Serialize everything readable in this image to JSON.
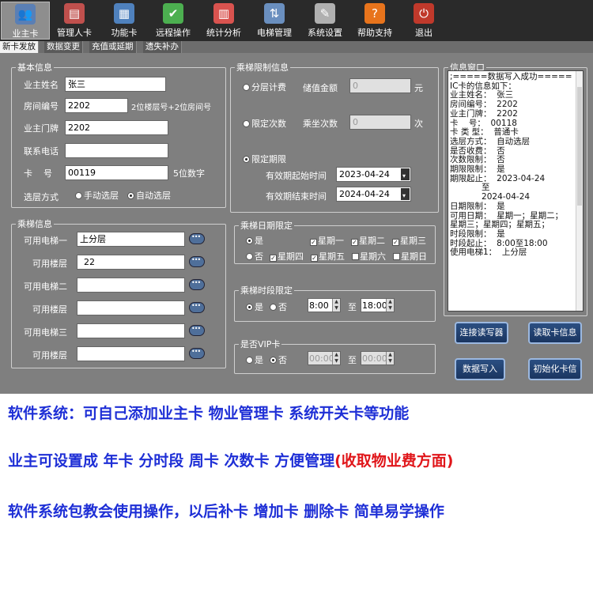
{
  "toolbar": {
    "items": [
      {
        "label": "业主卡",
        "icon": "users-icon",
        "color": "#5a7fb5"
      },
      {
        "label": "管理人卡",
        "icon": "id-card-icon",
        "color": "#c0504d"
      },
      {
        "label": "功能卡",
        "icon": "function-card-icon",
        "color": "#4f81bd"
      },
      {
        "label": "远程操作",
        "icon": "shield-check-icon",
        "color": "#4caf50"
      },
      {
        "label": "统计分析",
        "icon": "calendar-icon",
        "color": "#d9534f"
      },
      {
        "label": "电梯管理",
        "icon": "elevator-icon",
        "color": "#6a8fbf"
      },
      {
        "label": "系统设置",
        "icon": "wrench-icon",
        "color": "#b0b0b0"
      },
      {
        "label": "帮助支持",
        "icon": "help-icon",
        "color": "#e8741c"
      },
      {
        "label": "退出",
        "icon": "logout-icon",
        "color": "#c0392b"
      }
    ]
  },
  "tabs": [
    "新卡发放",
    "数据变更",
    "充值或延期",
    "遗失补办"
  ],
  "basic": {
    "legend": "基本信息",
    "owner_label": "业主姓名",
    "owner_value": "张三",
    "room_label": "房间编号",
    "room_value": "2202",
    "room_hint": "2位楼层号+2位房间号",
    "door_label": "业主门牌",
    "door_value": "2202",
    "phone_label": "联系电话",
    "phone_value": "",
    "card_label": "卡    号",
    "card_value": "00119",
    "card_hint": "5位数字",
    "floor_mode_label": "选层方式",
    "manual": "手动选层",
    "auto": "自动选层"
  },
  "limit": {
    "legend": "乘梯限制信息",
    "floor_fee": "分层计费",
    "stored_label": "储值金额",
    "stored_value": "0",
    "stored_unit": "元",
    "count_limit": "限定次数",
    "ride_label": "乘坐次数",
    "ride_value": "0",
    "ride_unit": "次",
    "period_limit": "限定期限",
    "start_label": "有效期起始时间",
    "start_value": "2023-04-24",
    "end_label": "有效期结束时间",
    "end_value": "2024-04-24"
  },
  "ride": {
    "legend": "乘梯信息",
    "rows": [
      {
        "label": "可用电梯一",
        "value": "上分层"
      },
      {
        "label": "可用楼层",
        "value": "22"
      },
      {
        "label": "可用电梯二",
        "value": ""
      },
      {
        "label": "可用楼层",
        "value": ""
      },
      {
        "label": "可用电梯三",
        "value": ""
      },
      {
        "label": "可用楼层",
        "value": ""
      }
    ]
  },
  "date_limit": {
    "legend": "乘梯日期限定",
    "yes": "是",
    "no": "否",
    "days": [
      {
        "label": "星期一",
        "checked": true
      },
      {
        "label": "星期二",
        "checked": true
      },
      {
        "label": "星期三",
        "checked": true
      },
      {
        "label": "星期四",
        "checked": true
      },
      {
        "label": "星期五",
        "checked": true
      },
      {
        "label": "星期六",
        "checked": false
      },
      {
        "label": "星期日",
        "checked": false
      }
    ]
  },
  "time_limit": {
    "legend": "乘梯时段限定",
    "yes": "是",
    "no": "否",
    "from": "8:00",
    "to_label": "至",
    "to": "18:00"
  },
  "vip": {
    "legend": "是否VIP卡",
    "yes": "是",
    "no": "否",
    "from": "00:00",
    "to_label": "至",
    "to": "00:00"
  },
  "info": {
    "legend": "信息窗口",
    "lines": [
      ";=====数据写入成功=====",
      "IC卡的信息如下：",
      "业主姓名：  张三",
      "房间编号：  2202",
      "业主门牌：  2202",
      "卡    号：  00118",
      "卡 类 型：  普通卡",
      "选层方式：  自动选层",
      "是否收费：  否",
      "次数限制：  否",
      "期限限制：  是",
      "期限起止：  2023-04-24",
      "            至",
      "            2024-04-24",
      "日期限制：  是",
      "可用日期：  星期一；星期二；",
      "星期三；星期四；星期五；",
      "时段限制：  是",
      "时段起止：  8:00至18:00",
      "使用电梯1：  上分层"
    ]
  },
  "actions": {
    "connect": "连接读写器",
    "read": "读取卡信息",
    "write": "数据写入",
    "init": "初始化卡信"
  },
  "promo": {
    "line1": "软件系统：可自己添加业主卡 物业管理卡 系统开关卡等功能",
    "line2_main": "业主可设置成 年卡 分时段 周卡 次数卡 方便管理",
    "line2_red": "(收取物业费方面)",
    "line3": "软件系统包教会使用操作，以后补卡 增加卡 删除卡 简单易学操作"
  }
}
